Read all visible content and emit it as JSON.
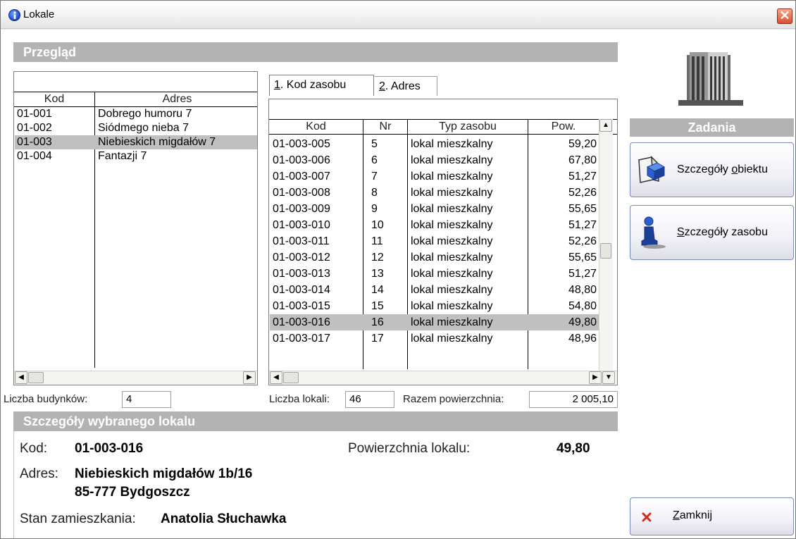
{
  "window": {
    "title": "Lokale",
    "close_glyph": "✕"
  },
  "overview": {
    "header": "Przegląd",
    "buildings": {
      "columns": [
        "Kod",
        "Adres"
      ],
      "rows": [
        {
          "kod": "01-001",
          "adres": "Dobrego humoru 7",
          "selected": false
        },
        {
          "kod": "01-002",
          "adres": "Siódmego nieba 7",
          "selected": false
        },
        {
          "kod": "01-003",
          "adres": "Niebieskich migdałów 7",
          "selected": true
        },
        {
          "kod": "01-004",
          "adres": "Fantazji 7",
          "selected": false
        }
      ],
      "count_label": "Liczba budynków:",
      "count_value": "4"
    },
    "tabs": [
      {
        "num": "1",
        "label": ". Kod zasobu"
      },
      {
        "num": "2",
        "label": ". Adres"
      }
    ],
    "resources": {
      "columns": [
        "Kod",
        "Nr",
        "Typ zasobu",
        "Pow."
      ],
      "rows": [
        {
          "kod": "01-003-005",
          "nr": "5",
          "typ": "lokal mieszkalny",
          "pow": "59,20",
          "selected": false
        },
        {
          "kod": "01-003-006",
          "nr": "6",
          "typ": "lokal mieszkalny",
          "pow": "67,80",
          "selected": false
        },
        {
          "kod": "01-003-007",
          "nr": "7",
          "typ": "lokal mieszkalny",
          "pow": "51,27",
          "selected": false
        },
        {
          "kod": "01-003-008",
          "nr": "8",
          "typ": "lokal mieszkalny",
          "pow": "52,26",
          "selected": false
        },
        {
          "kod": "01-003-009",
          "nr": "9",
          "typ": "lokal mieszkalny",
          "pow": "55,65",
          "selected": false
        },
        {
          "kod": "01-003-010",
          "nr": "10",
          "typ": "lokal mieszkalny",
          "pow": "51,27",
          "selected": false
        },
        {
          "kod": "01-003-011",
          "nr": "11",
          "typ": "lokal mieszkalny",
          "pow": "52,26",
          "selected": false
        },
        {
          "kod": "01-003-012",
          "nr": "12",
          "typ": "lokal mieszkalny",
          "pow": "55,65",
          "selected": false
        },
        {
          "kod": "01-003-013",
          "nr": "13",
          "typ": "lokal mieszkalny",
          "pow": "51,27",
          "selected": false
        },
        {
          "kod": "01-003-014",
          "nr": "14",
          "typ": "lokal mieszkalny",
          "pow": "48,80",
          "selected": false
        },
        {
          "kod": "01-003-015",
          "nr": "15",
          "typ": "lokal mieszkalny",
          "pow": "54,80",
          "selected": false
        },
        {
          "kod": "01-003-016",
          "nr": "16",
          "typ": "lokal mieszkalny",
          "pow": "49,80",
          "selected": true
        },
        {
          "kod": "01-003-017",
          "nr": "17",
          "typ": "lokal mieszkalny",
          "pow": "48,96",
          "selected": false
        }
      ],
      "count_label": "Liczba lokali:",
      "count_value": "46",
      "area_label": "Razem powierzchnia:",
      "area_value": "2 005,10"
    }
  },
  "details": {
    "header": "Szczegóły wybranego lokalu",
    "kod_label": "Kod:",
    "kod_value": "01-003-016",
    "area_label": "Powierzchnia lokalu:",
    "area_value": "49,80",
    "address_label": "Adres:",
    "address_line1": "Niebieskich migdałów 1b/16",
    "address_line2": "85-777 Bydgoszcz",
    "residents_label": "Stan zamieszkania:",
    "residents_value": "Anatolia Słuchawka"
  },
  "tasks": {
    "header": "Zadania",
    "object_details_pre": "Szczegóły ",
    "object_details_key": "o",
    "object_details_post": "biektu",
    "resource_details_key": "S",
    "resource_details_rest": "zczegóły zasobu",
    "close_key": "Z",
    "close_rest": "amknij"
  },
  "icons": {
    "title": "info-icon",
    "object": "book-cube-icon",
    "resource": "person-icon",
    "close": "red-x-icon",
    "building": "office-building-icon"
  },
  "colors": {
    "header_bg": "#b3b3b3",
    "selection_bg": "#c0c0c0",
    "close_red": "#d9512e"
  }
}
